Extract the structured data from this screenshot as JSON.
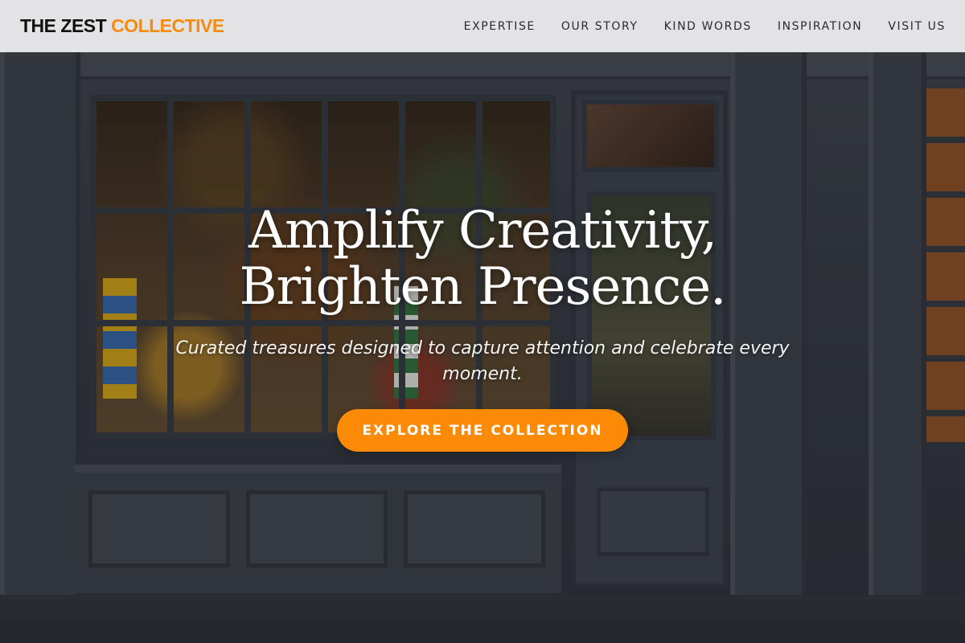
{
  "header": {
    "brand_primary": "THE ZEST",
    "brand_accent": "COLLECTIVE",
    "nav": [
      {
        "label": "EXPERTISE"
      },
      {
        "label": "OUR STORY"
      },
      {
        "label": "KIND WORDS"
      },
      {
        "label": "INSPIRATION"
      },
      {
        "label": "VISIT US"
      }
    ]
  },
  "hero": {
    "headline_line1": "Amplify Creativity,",
    "headline_line2": "Brighten Presence.",
    "subheadline": "Curated treasures designed to capture attention and celebrate every moment.",
    "cta_label": "EXPLORE THE COLLECTION",
    "background_image": "storefront-photo"
  },
  "colors": {
    "accent": "#fb8a06",
    "header_bg": "#eeeef0",
    "text_dark": "#111111"
  }
}
